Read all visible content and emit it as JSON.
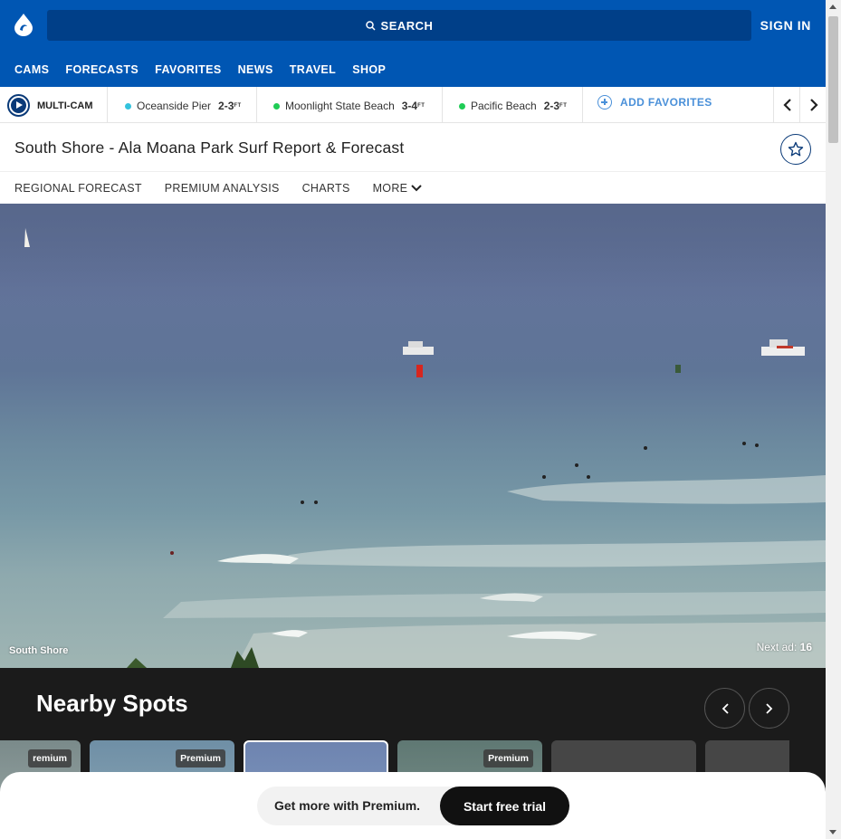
{
  "header": {
    "search_label": "SEARCH",
    "signin_label": "SIGN IN",
    "nav": [
      "CAMS",
      "FORECASTS",
      "FAVORITES",
      "NEWS",
      "TRAVEL",
      "SHOP"
    ]
  },
  "favorites_bar": {
    "multicam_label": "MULTI-CAM",
    "spots": [
      {
        "name": "Oceanside Pier",
        "height": "2-3",
        "unit": "FT",
        "color": "#33c3dd"
      },
      {
        "name": "Moonlight State Beach",
        "height": "3-4",
        "unit": "FT",
        "color": "#1fcc55"
      },
      {
        "name": "Pacific Beach",
        "height": "2-3",
        "unit": "FT",
        "color": "#1fcc55"
      }
    ],
    "add_favorites_label": "ADD FAVORITES"
  },
  "page": {
    "title": "South Shore - Ala Moana Park Surf Report & Forecast",
    "subnav": [
      "REGIONAL FORECAST",
      "PREMIUM ANALYSIS",
      "CHARTS",
      "MORE"
    ]
  },
  "cam": {
    "label": "South Shore",
    "next_ad_label": "Next ad:",
    "next_ad_seconds": "16"
  },
  "nearby": {
    "title": "Nearby Spots",
    "badge_label": "Premium",
    "partial_badge_label": "remium"
  },
  "premium_banner": {
    "text": "Get more with Premium.",
    "cta_label": "Start free trial"
  },
  "colors": {
    "brand_blue": "#0056b3",
    "search_bg": "#003f88",
    "dark_section": "#1b1b1b"
  }
}
